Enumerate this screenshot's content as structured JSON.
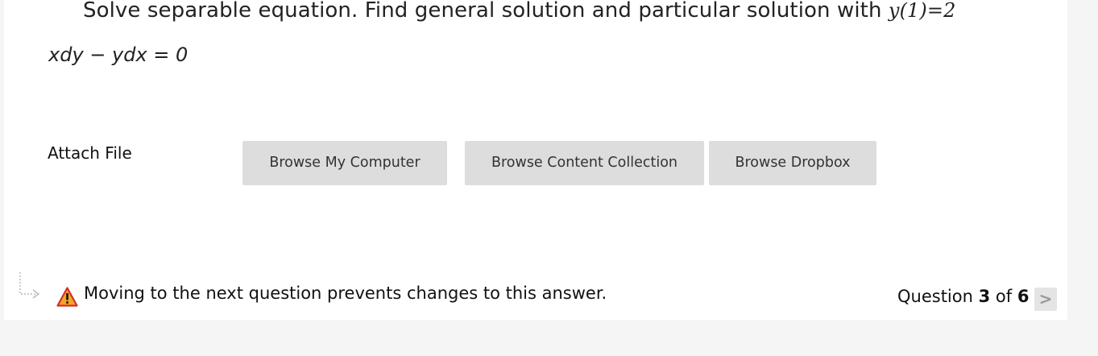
{
  "question": {
    "prompt": "Solve separable equation. Find general solution and particular solution with ",
    "condition": "y(1)=2",
    "equation": "xdy − ydx = 0"
  },
  "attach": {
    "label": "Attach File",
    "buttons": {
      "computer": "Browse My Computer",
      "collection": "Browse Content Collection",
      "dropbox": "Browse Dropbox"
    }
  },
  "footer": {
    "warning": "Moving to the next question prevents changes to this answer.",
    "counter_prefix": "Question ",
    "current": "3",
    "counter_of": " of ",
    "total": "6",
    "next_glyph": ">"
  },
  "colors": {
    "warning_fill": "#f5a623",
    "warning_border": "#d32f2f"
  }
}
